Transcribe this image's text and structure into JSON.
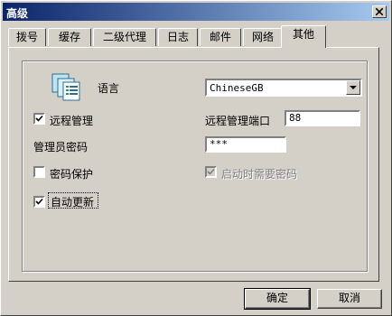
{
  "window": {
    "title": "高级"
  },
  "tabs": [
    {
      "label": "拨号"
    },
    {
      "label": "缓存"
    },
    {
      "label": "二级代理"
    },
    {
      "label": "日志"
    },
    {
      "label": "邮件"
    },
    {
      "label": "网络"
    },
    {
      "label": "其他",
      "active": true
    }
  ],
  "settings": {
    "language_label": "语言",
    "language_value": "ChineseGB",
    "remote_manage_label": "远程管理",
    "remote_manage_checked": true,
    "remote_port_label": "远程管理端口",
    "remote_port_value": "88",
    "admin_password_label": "管理员密码",
    "admin_password_value": "***",
    "password_protect_label": "密码保护",
    "password_protect_checked": false,
    "startup_password_label": "启动时需要密码",
    "startup_password_checked": true,
    "startup_password_enabled": false,
    "auto_update_label": "自动更新",
    "auto_update_checked": true
  },
  "buttons": {
    "ok": "确定",
    "cancel": "取消"
  },
  "icons": {
    "close": "close-icon",
    "app": "file-stack-icon",
    "dropdown": "chevron-down-icon",
    "check": "check-icon"
  }
}
